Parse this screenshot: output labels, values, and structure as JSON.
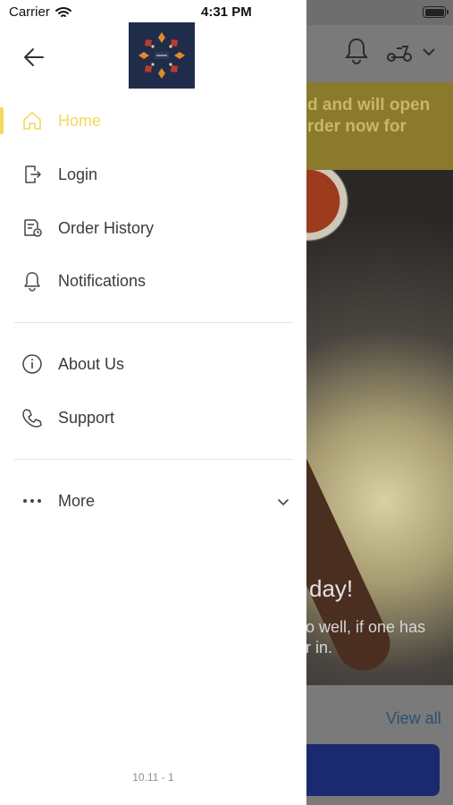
{
  "status_bar": {
    "carrier": "Carrier",
    "time": "4:31 PM"
  },
  "drawer": {
    "nav_items": [
      {
        "label": "Home",
        "icon": "home-icon",
        "active": true
      },
      {
        "label": "Login",
        "icon": "login-icon",
        "active": false
      },
      {
        "label": "Order History",
        "icon": "order-history-icon",
        "active": false
      },
      {
        "label": "Notifications",
        "icon": "bell-icon",
        "active": false
      }
    ],
    "info_items": [
      {
        "label": "About Us",
        "icon": "info-icon"
      },
      {
        "label": "Support",
        "icon": "phone-icon"
      }
    ],
    "more": {
      "label": "More",
      "icon": "more-dots-icon"
    },
    "version": "10.11 - 1"
  },
  "background": {
    "banner_text": "d and will open\nrder now for",
    "hero_title": "day!",
    "hero_text": "o well, if one has\nr in.",
    "view_all": "View all"
  },
  "colors": {
    "accent": "#f2d95c",
    "text": "#3b3b3b",
    "divider": "#e4e4e4",
    "logo_bg": "#1f2d4a"
  }
}
